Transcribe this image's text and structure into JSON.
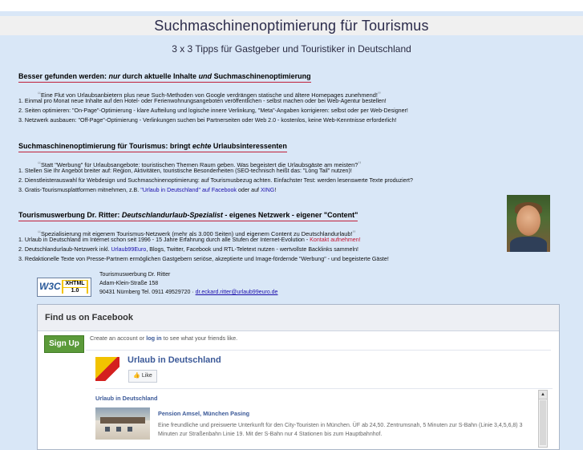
{
  "header": {
    "title": "Suchmaschinenoptimierung für Tourismus",
    "subtitle": "3 x 3 Tipps für Gastgeber und Touristiker in Deutschland"
  },
  "sections": [
    {
      "heading_pre": "Besser gefunden werden: ",
      "heading_em1": "nur",
      "heading_mid": " durch aktuelle Inhalte ",
      "heading_em2": "und",
      "heading_post": " Suchmaschinenoptimierung",
      "quote": "Eine Flut von Urlaubsanbietern plus neue Such-Methoden von Google verdrängen statische und ältere Homepages zunehmend!",
      "items": [
        "1. Einmal pro Monat neue Inhalte auf den Hotel- oder Ferienwohnungsangeboten veröffentlichen - selbst machen oder bei Web-Agentur bestellen!",
        "2. Seiten optimieren: \"On-Page\"-Optimierung - klare Aufteilung und logische innere Verlinkung, \"Meta\"-Angaben korrigieren: selbst oder per Web-Designer!",
        "3. Netzwerk ausbauen: \"Off-Page\"-Optimierung - Verlinkungen suchen bei Partnerseiten oder Web 2.0 - kostenlos, keine Web-Kenntnisse erforderlich!"
      ]
    },
    {
      "heading_pre": "Suchmaschinenoptimierung für Tourismus: bringt ",
      "heading_em1": "echte",
      "heading_post": " Urlaubsinteressenten",
      "quote": "Statt \"Werbung\" für Urlaubsangebote: touristischen Themen Raum geben. Was begeistert die Urlaubsgäste am meisten?",
      "items": [
        "1. Stellen Sie Ihr Angebot breiter auf: Region, Aktivitäten, touristische Besonderheiten (SEO-technisch heißt das: \"Long Tail\" nutzen)!",
        "2. Dienstleisterauswahl für Webdesign und Suchmaschinenoptimierung: auf Tourismusbezug achten. Einfachster Test: werden lesenswerte Texte produziert?"
      ],
      "item3_pre": "3. Gratis-Tourismusplattformen mitnehmen, z.B. ",
      "item3_link1": "\"Urlaub in Deutschland\" auf Facebook",
      "item3_mid": " oder auf ",
      "item3_link2": "XING",
      "item3_post": "!"
    },
    {
      "heading_pre": "Tourismuswerbung Dr. Ritter: ",
      "heading_em1": "Deutschlandurlaub-Spezialist",
      "heading_post": " - eigenes Netzwerk - eigener \"Content\"",
      "quote": "Spezialisierung mit eigenem Tourismus-Netzwerk (mehr als 3.000 Seiten) und eigenem Content zu Deutschlandurlaub!",
      "item1_pre": "1. Urlaub in Deutschland im Internet schon seit 1996 - 15 Jahre Erfahrung durch alle Stufen der Internet-Evolution - ",
      "item1_link": "Kontakt aufnehmen!",
      "item2_pre": "2. Deutschlandurlaub-Netzwerk inkl. ",
      "item2_link": "Urlaub99Euro",
      "item2_post": ", Blogs, Twitter, Facebook und RTL-Teletext nutzen - wertvollste Backlinks sammeln!",
      "item3": "3. Redaktionelle Texte von Presse-Partnern ermöglichen Gastgebern seriöse, akzeptierte und Image-fördernde \"Werbung\" - und begeisterte Gäste!"
    }
  ],
  "badge": {
    "w3c": "W3C",
    "xhtml": "XHTML",
    "version": "1.0"
  },
  "contact": {
    "name": "Tourismuswerbung Dr. Ritter",
    "street": "Adam-Klein-Straße 158",
    "city_phone": "90431 Nürnberg Tel. 0911 49529720 · ",
    "email": "dr.eckard.ritter@urlaub99euro.de"
  },
  "facebook": {
    "header": "Find us on Facebook",
    "signup": "Sign Up",
    "create_pre": "Create an account or ",
    "create_link": "log in",
    "create_post": " to see what your friends like.",
    "page_name": "Urlaub in Deutschland",
    "like_label": "Like",
    "post_page": "Urlaub in Deutschland",
    "post_title": "Pension Amsel, München Pasing",
    "post_text": "Eine freundliche und preiswerte Unterkunft für den City-Touristen in München. ÜF ab 24,50. Zentrumsnah, 5 Minuten zur S-Bahn (Linie 3,4,5,6,8) 3 Minuten zur Straßenbahn Linie 19. Mit der S-Bahn nur 4 Stationen bis zum Hauptbahnhof."
  }
}
